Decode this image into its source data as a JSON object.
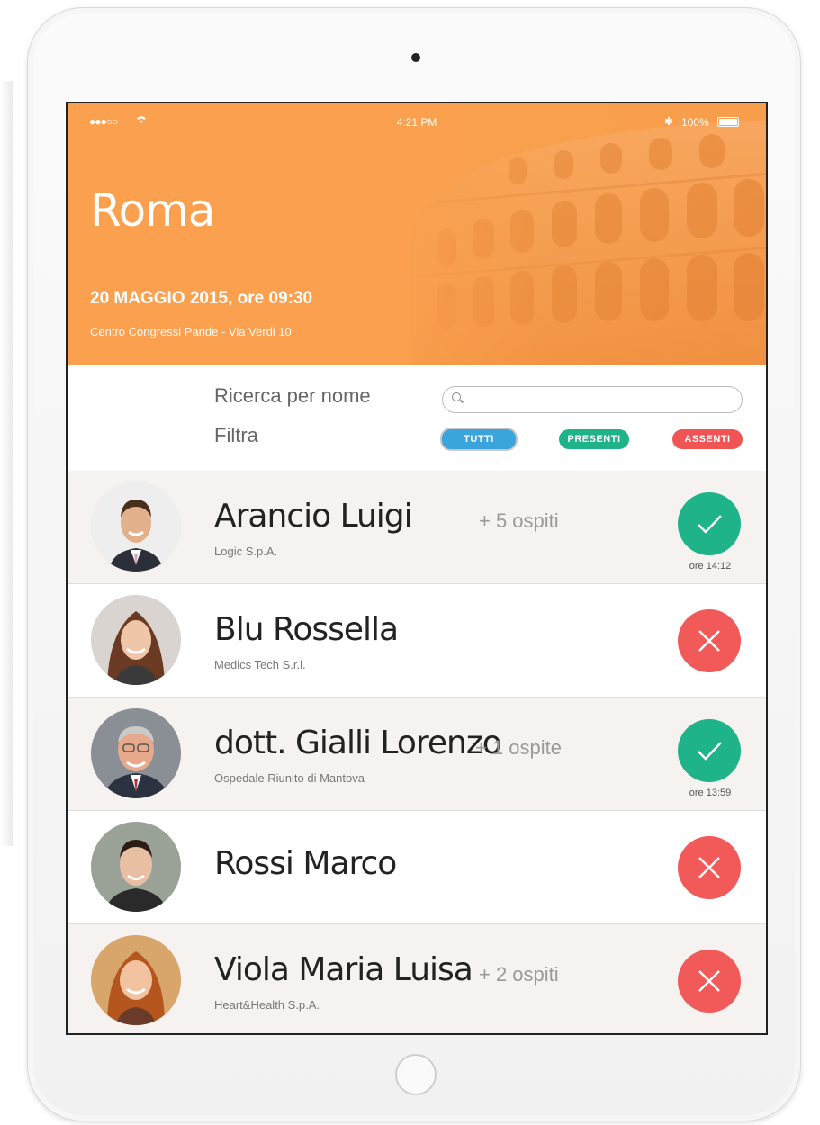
{
  "status_bar": {
    "signal": "●●●○○",
    "wifi": "wifi",
    "time": "4:21 PM",
    "battery": "100%"
  },
  "header": {
    "city": "Roma",
    "datetime": "20 MAGGIO 2015, ore 09:30",
    "venue": "Centro Congressi Paride - Via Verdi 10",
    "accent_color": "#f8a04c"
  },
  "search": {
    "label": "Ricerca per nome",
    "placeholder": ""
  },
  "filter": {
    "label": "Filtra",
    "options": [
      {
        "label": "TUTTI",
        "color": "#3aa4dd",
        "selected": true
      },
      {
        "label": "PRESENTI",
        "color": "#1fb38a",
        "selected": false
      },
      {
        "label": "ASSENTI",
        "color": "#f05454",
        "selected": false
      }
    ]
  },
  "attendees": [
    {
      "name": "Arancio Luigi",
      "company": "Logic S.p.A.",
      "guests": "+ 5 ospiti",
      "status": "present",
      "checkin": "ore 14:12"
    },
    {
      "name": "Blu Rossella",
      "company": "Medics Tech S.r.l.",
      "guests": "",
      "status": "absent",
      "checkin": ""
    },
    {
      "name": "dott. Gialli Lorenzo",
      "company": "Ospedale Riunito di Mantova",
      "guests": "+ 1 ospite",
      "status": "present",
      "checkin": "ore 13:59"
    },
    {
      "name": "Rossi Marco",
      "company": "",
      "guests": "",
      "status": "absent",
      "checkin": ""
    },
    {
      "name": "Viola Maria Luisa",
      "company": "Heart&Health S.p.A.",
      "guests": "+ 2 ospiti",
      "status": "absent",
      "checkin": ""
    }
  ]
}
